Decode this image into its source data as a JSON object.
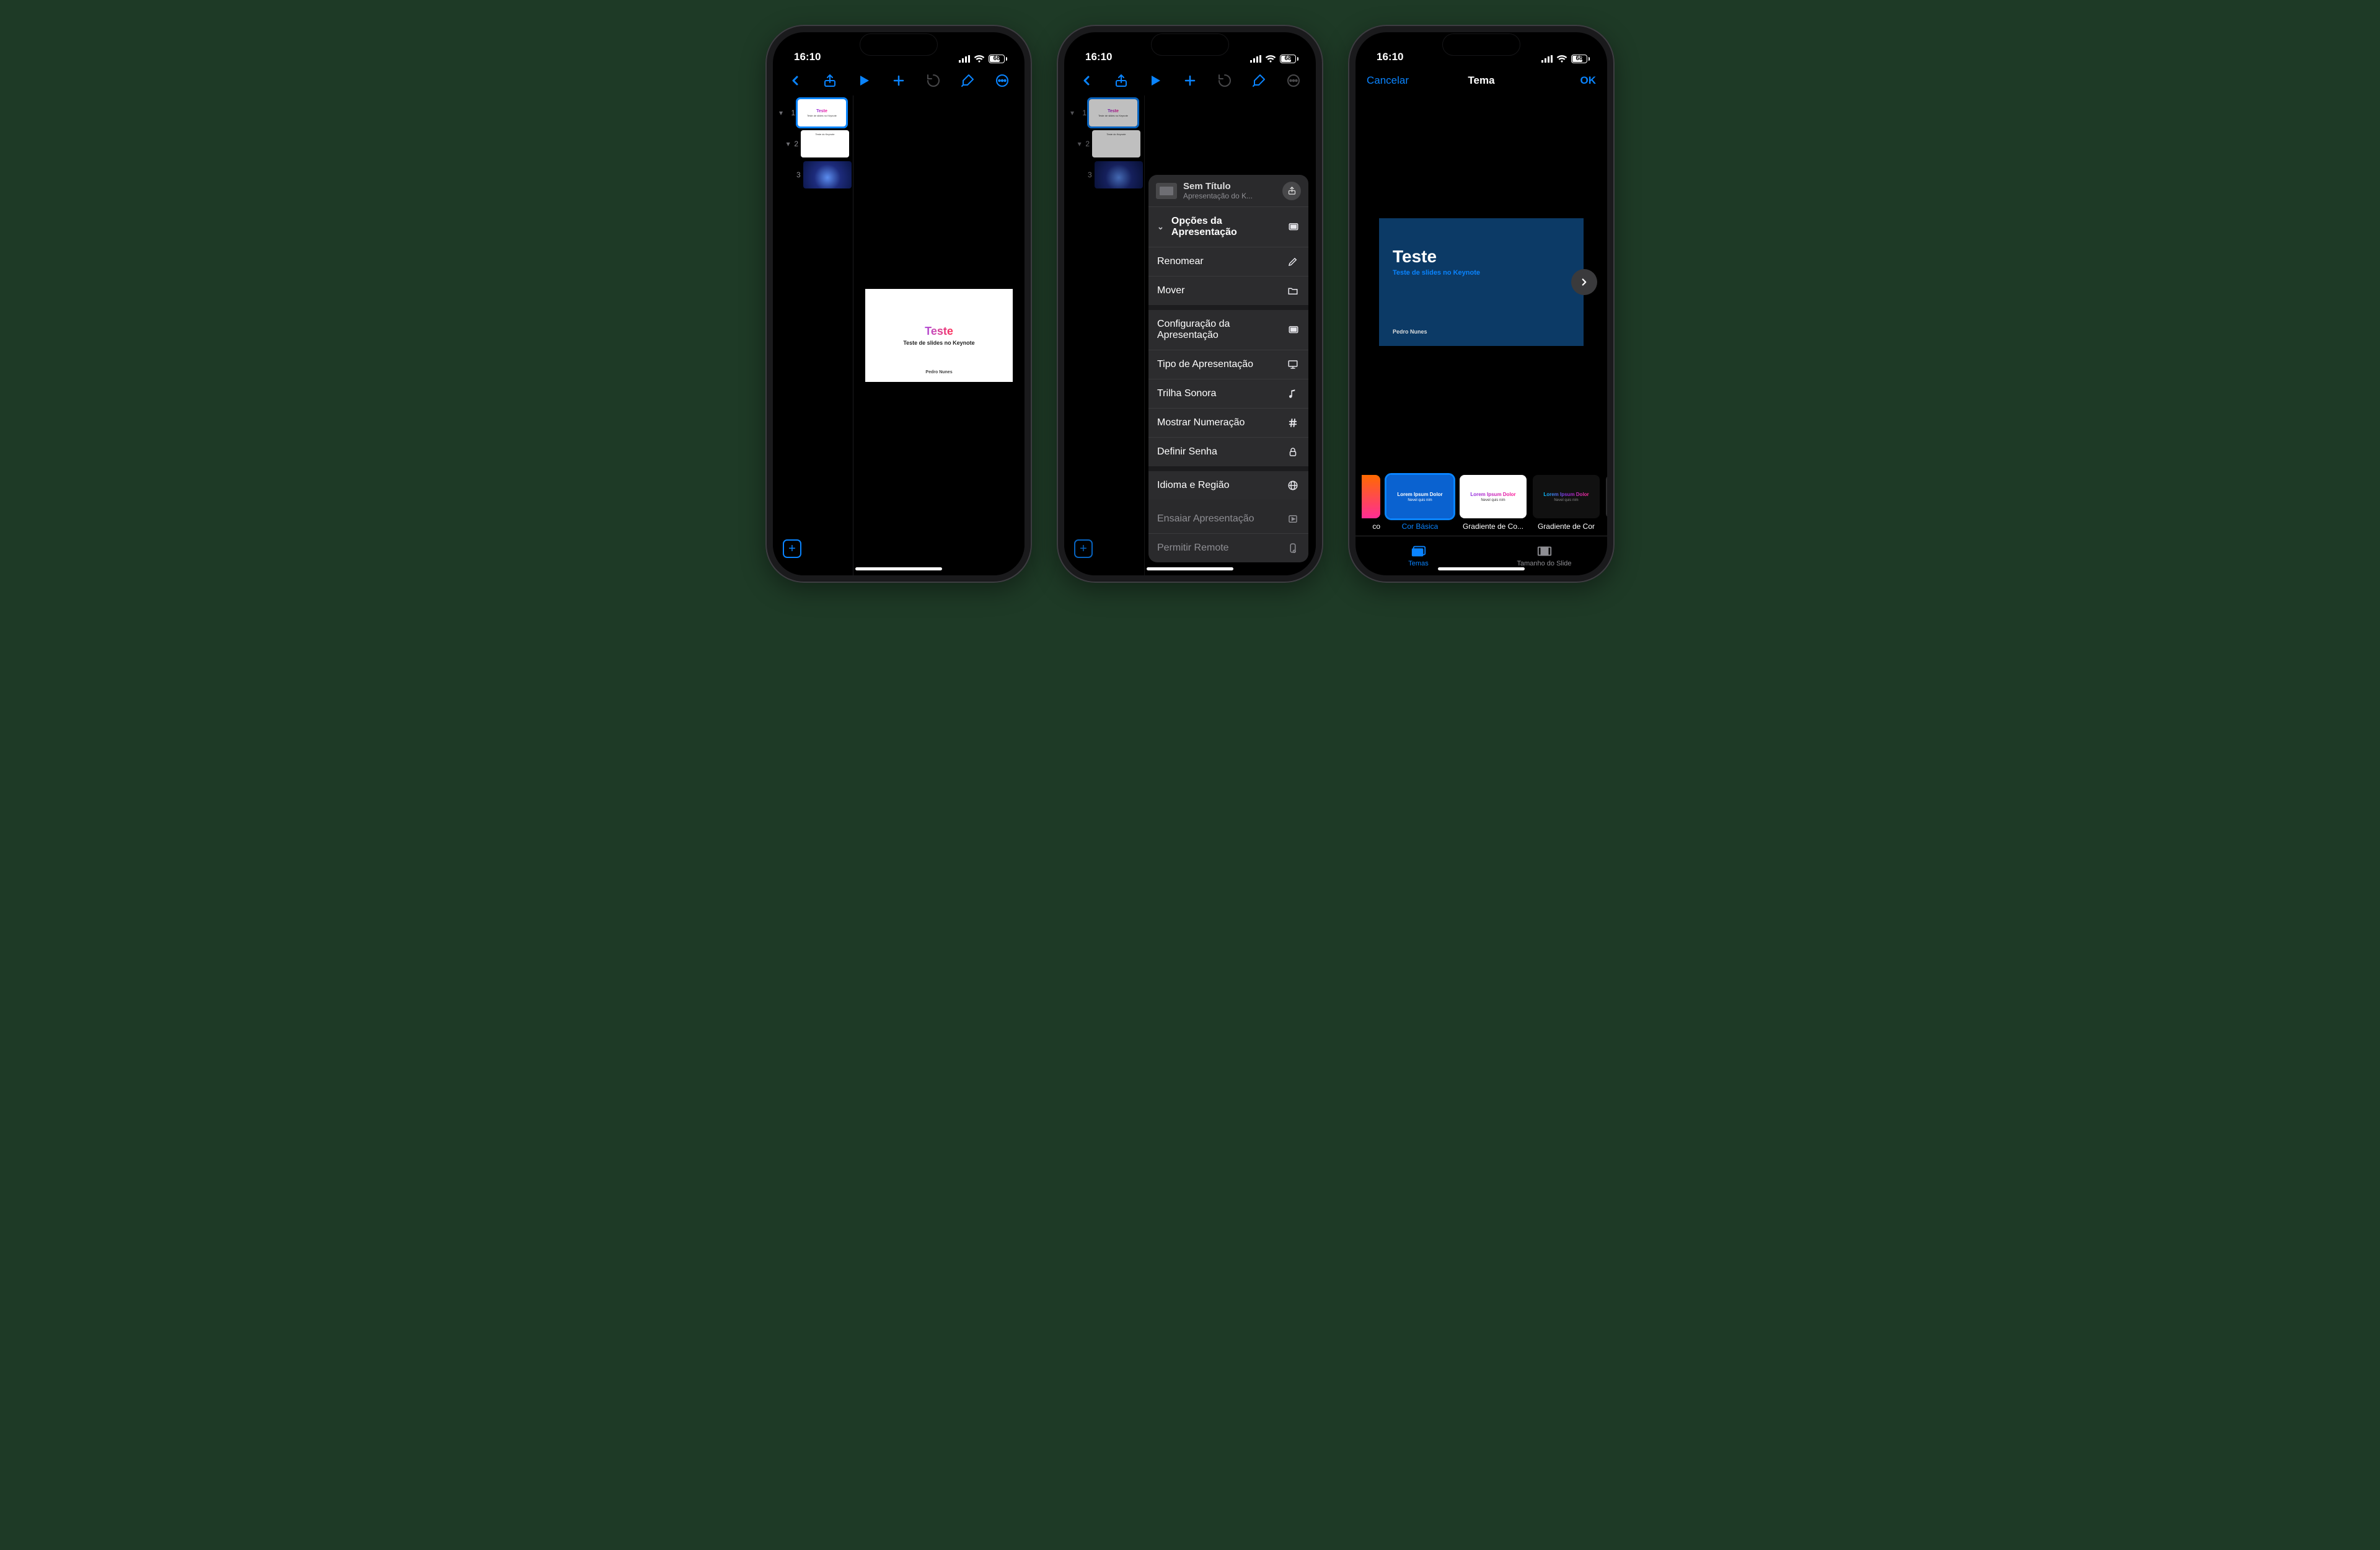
{
  "status": {
    "time": "16:10",
    "battery": "68"
  },
  "document": {
    "title": "Sem Título",
    "kind": "Apresentação do K..."
  },
  "slides": [
    {
      "n": "1",
      "title": "Teste",
      "sub": "Teste de slides no Keynote"
    },
    {
      "n": "2",
      "heading": "Teste do Keynote"
    },
    {
      "n": "3"
    }
  ],
  "main_slide": {
    "title": "Teste",
    "sub": "Teste de slides no Keynote",
    "author": "Pedro Nunes"
  },
  "popover": {
    "section": "Opções da Apresentação",
    "items": {
      "rename": "Renomear",
      "move": "Mover",
      "config": "Configuração da Apresentação",
      "type": "Tipo de Apresentação",
      "soundtrack": "Trilha Sonora",
      "numbering": "Mostrar Numeração",
      "password": "Definir Senha",
      "language": "Idioma e Região",
      "rehearse": "Ensaiar Apresentação",
      "remote": "Permitir Remote"
    }
  },
  "themes_modal": {
    "cancel": "Cancelar",
    "title": "Tema",
    "ok": "OK",
    "preview": {
      "title": "Teste",
      "sub": "Teste de slides no Keynote",
      "author": "Pedro Nunes"
    },
    "themes": {
      "partial_left": "co",
      "blue": "Cor Básica",
      "white": "Gradiente de Co...",
      "dark": "Gradiente de Cor"
    },
    "sample": {
      "title": "Lorem Ipsum Dolor",
      "sub": "Nevel quis nim"
    },
    "tabs": {
      "themes": "Temas",
      "size": "Tamanho do Slide"
    }
  }
}
